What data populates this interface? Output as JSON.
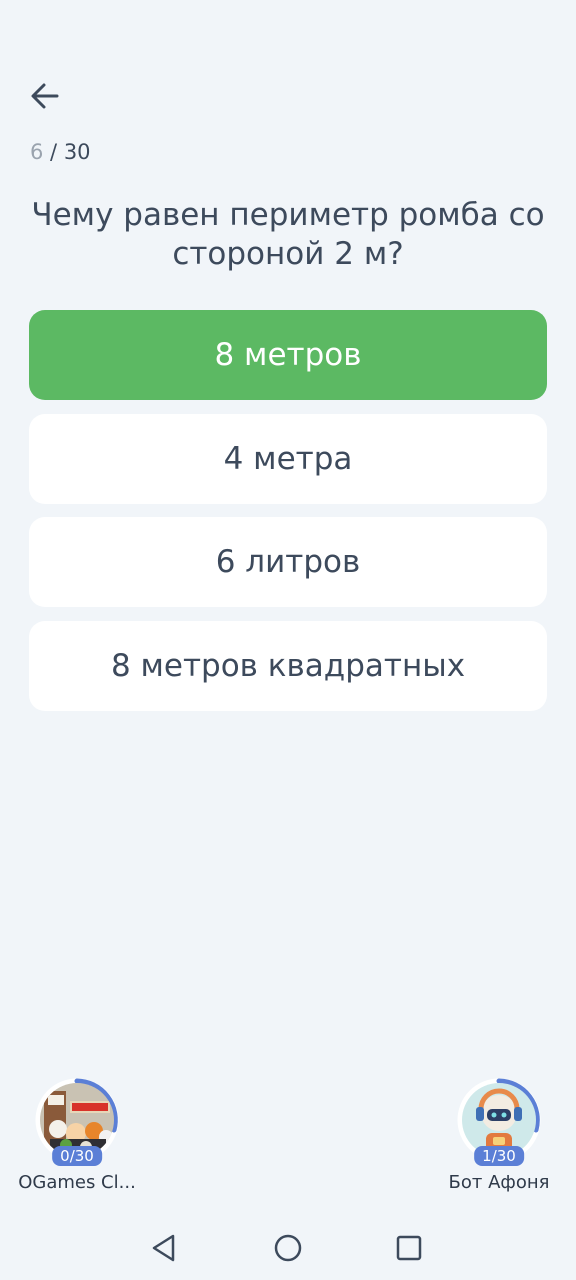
{
  "progress": {
    "current": "6",
    "separator": " / ",
    "total": "30"
  },
  "question": "Чему равен периметр ромба со стороной 2 м?",
  "answers": [
    {
      "label": "8 метров",
      "state": "correct"
    },
    {
      "label": "4 метра",
      "state": "default"
    },
    {
      "label": "6 литров",
      "state": "default"
    },
    {
      "label": "8 метров квадратных",
      "state": "default"
    }
  ],
  "players": [
    {
      "name": "OGames Cl...",
      "score": "0/30",
      "progress": 0.33
    },
    {
      "name": "Бот Афоня",
      "score": "1/30",
      "progress": 0.33
    }
  ],
  "colors": {
    "background": "#f1f5f9",
    "correct": "#5cb963",
    "text": "#3d4a5c",
    "badge": "#5b7fd6",
    "ring": "#5b7fd6"
  },
  "icons": {
    "back": "arrow-left-icon",
    "nav_back": "triangle-back-icon",
    "nav_home": "circle-home-icon",
    "nav_recents": "square-recents-icon"
  }
}
